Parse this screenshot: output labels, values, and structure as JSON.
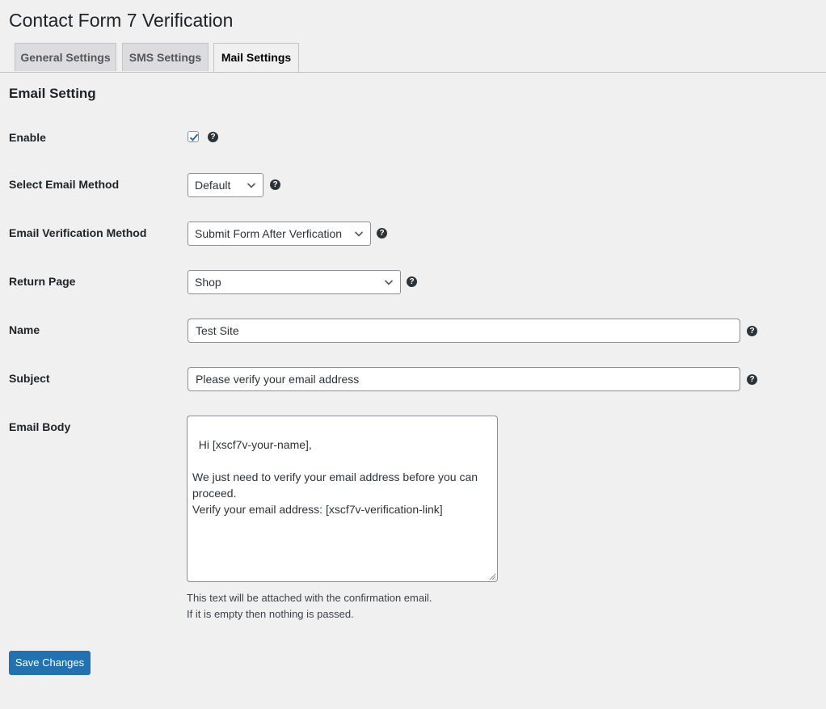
{
  "page": {
    "title": "Contact Form 7 Verification"
  },
  "tabs": [
    {
      "label": "General Settings",
      "active": false
    },
    {
      "label": "SMS Settings",
      "active": false
    },
    {
      "label": "Mail Settings",
      "active": true
    }
  ],
  "section": {
    "title": "Email Setting"
  },
  "fields": {
    "enable": {
      "label": "Enable",
      "checked": true
    },
    "email_method": {
      "label": "Select Email Method",
      "value": "Default"
    },
    "verification_method": {
      "label": "Email Verification Method",
      "value": "Submit Form After Verfication"
    },
    "return_page": {
      "label": "Return Page",
      "value": "Shop"
    },
    "name": {
      "label": "Name",
      "value": "Test Site"
    },
    "subject": {
      "label": "Subject",
      "value": "Please verify your email address"
    },
    "email_body": {
      "label": "Email Body",
      "value": "Hi [xscf7v-your-name],\n\nWe just need to verify your email address before you can proceed.\nVerify your email address: [xscf7v-verification-link]",
      "description_line1": "This text will be attached with the confirmation email.",
      "description_line2": "If it is empty then nothing is passed."
    }
  },
  "help_icon": "?",
  "actions": {
    "save_label": "Save Changes"
  },
  "colors": {
    "primary": "#2271b1",
    "background": "#f0f0f1",
    "check": "#2271b1"
  }
}
